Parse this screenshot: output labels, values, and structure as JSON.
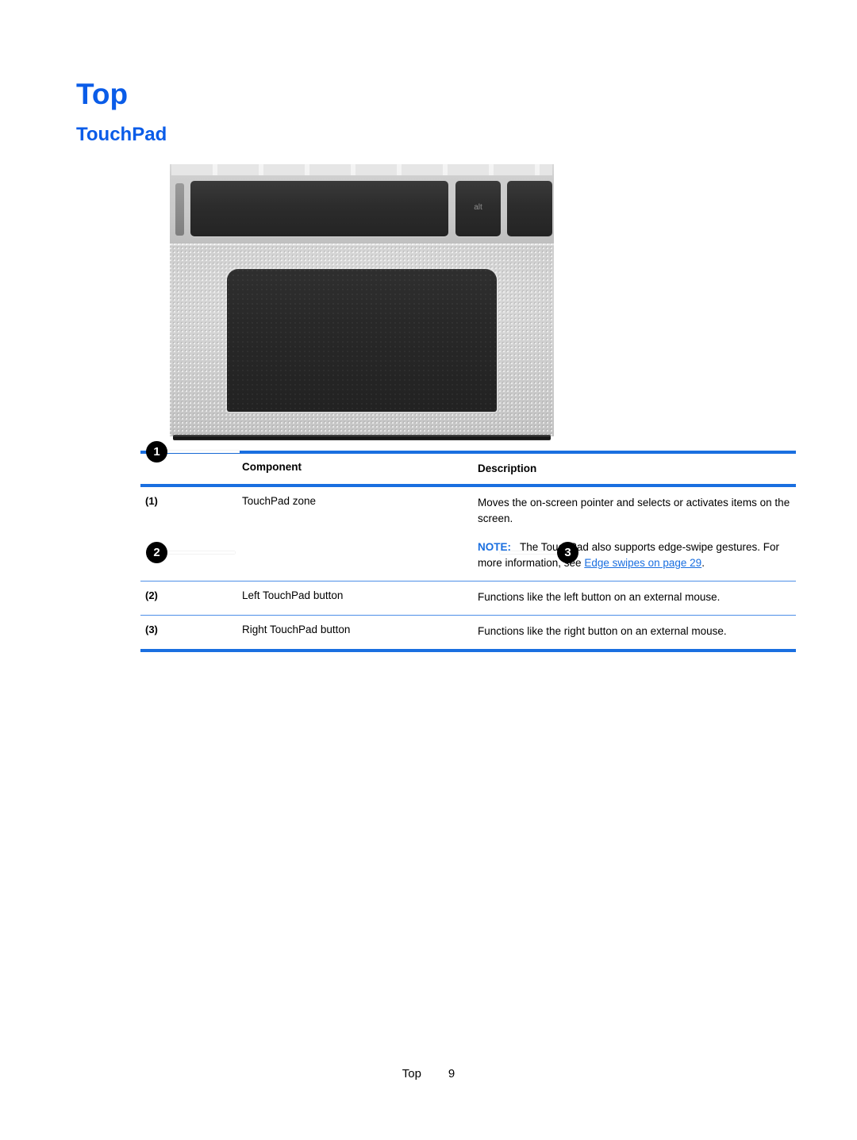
{
  "document": {
    "heading": "Top",
    "subheading": "TouchPad"
  },
  "colors": {
    "heading_blue": "#0a5ce8",
    "rule_blue": "#1a6fe0",
    "link_blue": "#1a6fe0",
    "page_background": "#ffffff"
  },
  "illustration": {
    "caption_alt_text": "Top view of laptop palmrest showing TouchPad zone and left and right TouchPad buttons",
    "keyboard_key_label": "alt",
    "callouts": [
      {
        "number": "1",
        "points_to": "touchpad-zone"
      },
      {
        "number": "2",
        "points_to": "left-touchpad-button"
      },
      {
        "number": "3",
        "points_to": "right-touchpad-button"
      }
    ]
  },
  "table": {
    "headers": {
      "component": "Component",
      "description": "Description"
    },
    "rows": [
      {
        "number": "(1)",
        "component": "TouchPad zone",
        "description": "Moves the on-screen pointer and selects or activates items on the screen.",
        "note": {
          "label": "NOTE:",
          "text_before_link": "The TouchPad also supports edge-swipe gestures. For more information, see ",
          "link_text": "Edge swipes on page 29",
          "text_after_link": "."
        }
      },
      {
        "number": "(2)",
        "component": "Left TouchPad button",
        "description": "Functions like the left button on an external mouse."
      },
      {
        "number": "(3)",
        "component": "Right TouchPad button",
        "description": "Functions like the right button on an external mouse."
      }
    ]
  },
  "footer": {
    "section": "Top",
    "page_number": "9"
  }
}
